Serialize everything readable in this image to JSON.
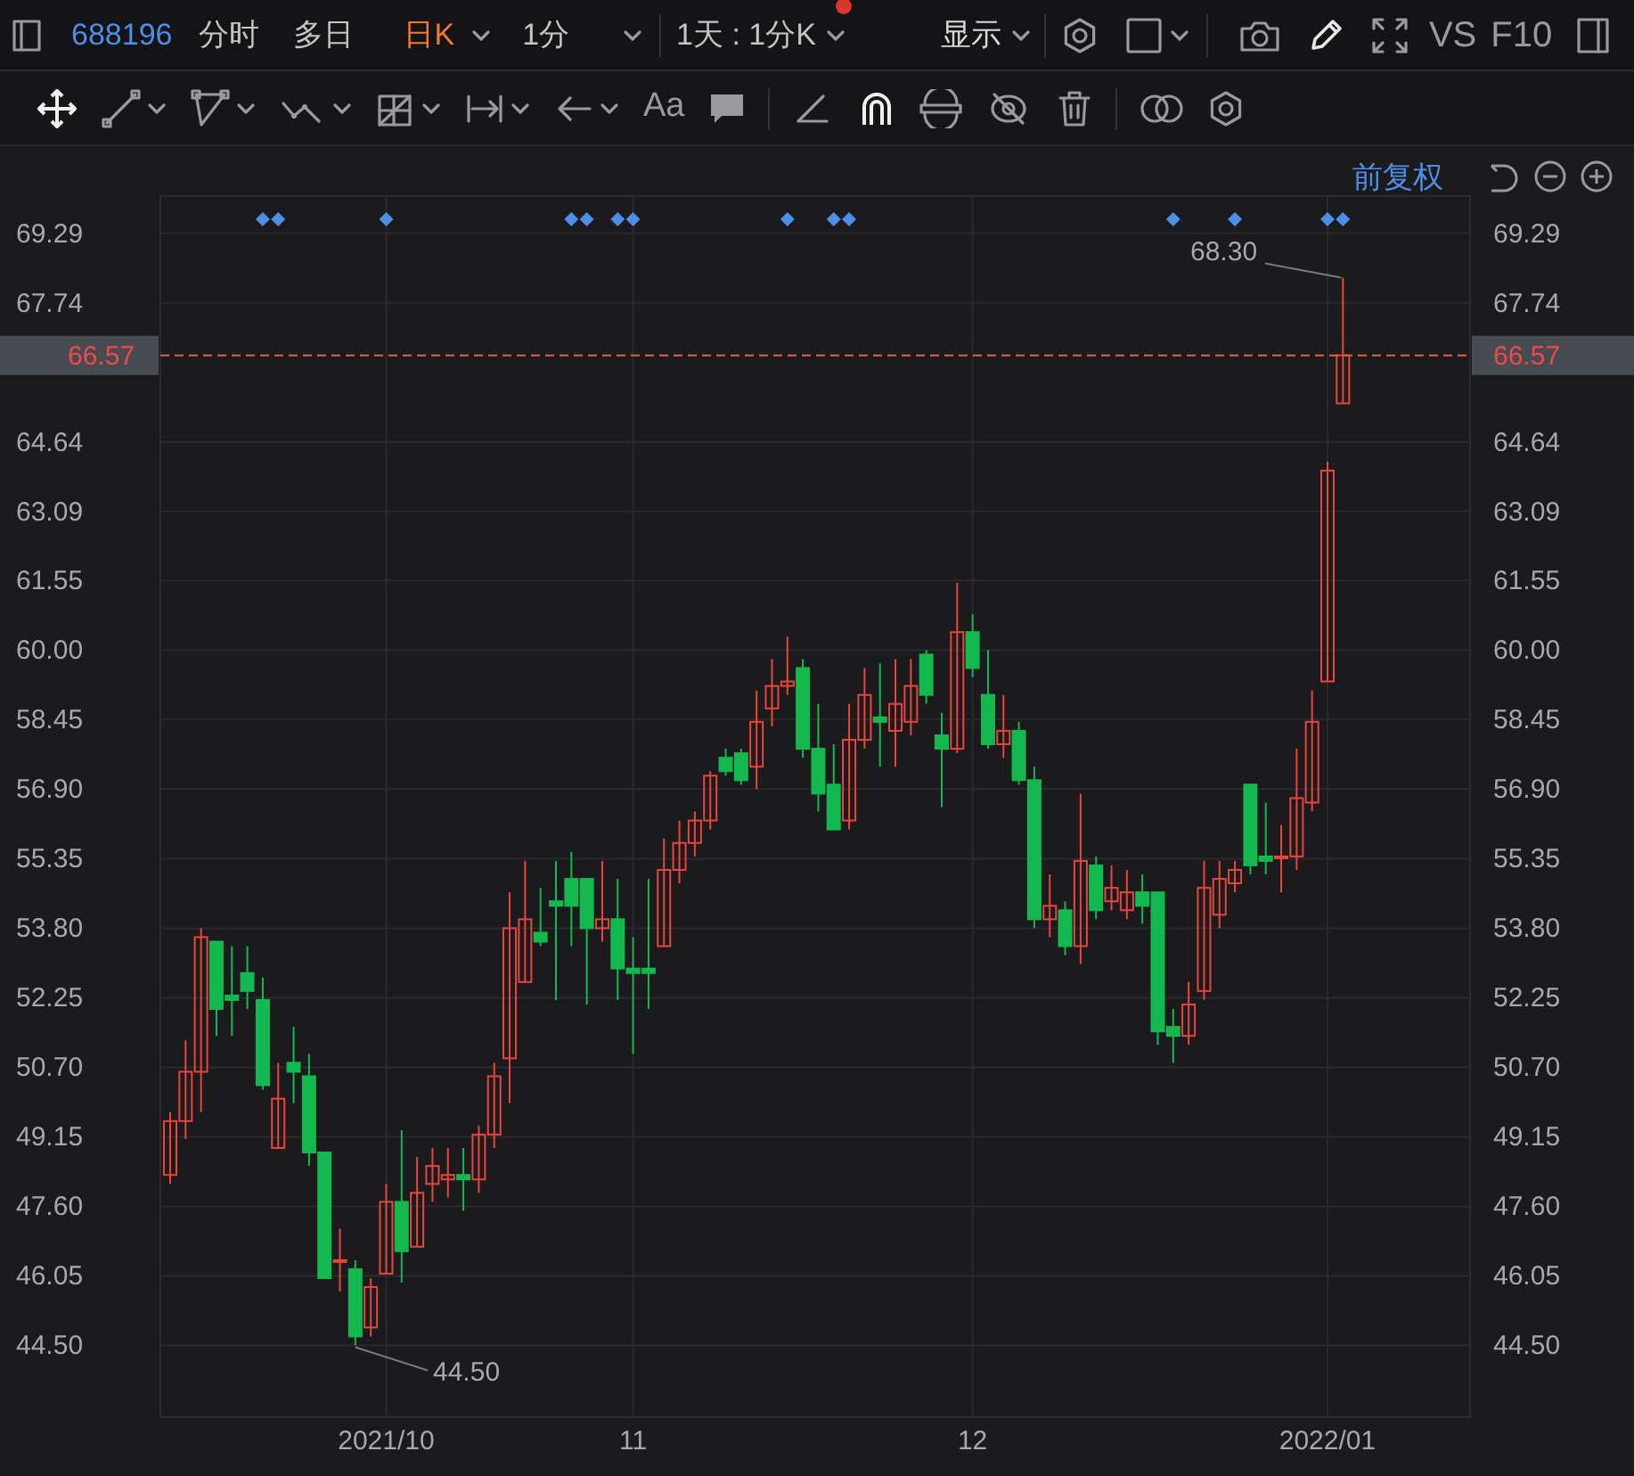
{
  "header": {
    "symbol": "688196",
    "period_tabs": [
      {
        "label": "分时",
        "selected": false
      },
      {
        "label": "多日",
        "selected": false
      },
      {
        "label": "日K",
        "selected": true
      },
      {
        "label": "1分",
        "selected": false
      }
    ],
    "interval": "1天 : 1分K",
    "interval_alert": true,
    "display_menu": "显示",
    "vs": "VS",
    "f10": "F10"
  },
  "drawing_toolbar": {
    "text_tool": "Aa"
  },
  "adjust_mode": "前复权",
  "chart_data": {
    "type": "candlestick",
    "grid": true,
    "ylim": [
      42.9,
      70.12
    ],
    "yticks": [
      {
        "value": 69.29,
        "label": "69.29"
      },
      {
        "value": 67.74,
        "label": "67.74"
      },
      {
        "value": 64.64,
        "label": "64.64"
      },
      {
        "value": 63.09,
        "label": "63.09"
      },
      {
        "value": 61.55,
        "label": "61.55"
      },
      {
        "value": 60,
        "label": "60.00"
      },
      {
        "value": 58.45,
        "label": "58.45"
      },
      {
        "value": 56.9,
        "label": "56.90"
      },
      {
        "value": 55.35,
        "label": "55.35"
      },
      {
        "value": 53.8,
        "label": "53.80"
      },
      {
        "value": 52.25,
        "label": "52.25"
      },
      {
        "value": 50.7,
        "label": "50.70"
      },
      {
        "value": 49.15,
        "label": "49.15"
      },
      {
        "value": 47.6,
        "label": "47.60"
      },
      {
        "value": 46.05,
        "label": "46.05"
      },
      {
        "value": 44.5,
        "label": "44.50"
      }
    ],
    "categories": [
      null,
      null,
      null,
      null,
      null,
      null,
      null,
      null,
      null,
      null,
      null,
      null,
      null,
      null,
      "2021/10",
      null,
      null,
      null,
      null,
      null,
      null,
      null,
      null,
      null,
      null,
      null,
      null,
      null,
      null,
      null,
      "11",
      null,
      null,
      null,
      null,
      null,
      null,
      null,
      null,
      null,
      null,
      null,
      null,
      null,
      null,
      null,
      null,
      null,
      null,
      null,
      null,
      null,
      "12",
      null,
      null,
      null,
      null,
      null,
      null,
      null,
      null,
      null,
      null,
      null,
      null,
      null,
      null,
      null,
      null,
      null,
      null,
      null,
      null,
      null,
      null,
      "2022/01",
      null
    ],
    "ohlc": [
      [
        48.3,
        49.7,
        48.1,
        49.5
      ],
      [
        49.5,
        51.3,
        49.1,
        50.6
      ],
      [
        50.6,
        53.8,
        49.7,
        53.6
      ],
      [
        53.5,
        53.5,
        51.4,
        52.0
      ],
      [
        52.3,
        53.4,
        51.4,
        52.2
      ],
      [
        52.8,
        53.4,
        52.0,
        52.4
      ],
      [
        52.2,
        52.7,
        50.2,
        50.3
      ],
      [
        48.9,
        50.8,
        48.9,
        50.0
      ],
      [
        50.8,
        51.6,
        49.9,
        50.6
      ],
      [
        50.5,
        51.0,
        48.5,
        48.8
      ],
      [
        48.8,
        48.8,
        46.0,
        46.0
      ],
      [
        46.4,
        47.1,
        45.7,
        46.4
      ],
      [
        46.2,
        46.4,
        44.5,
        44.7
      ],
      [
        44.9,
        46.0,
        44.7,
        45.8
      ],
      [
        46.1,
        48.1,
        46.1,
        47.7
      ],
      [
        47.7,
        49.3,
        45.9,
        46.6
      ],
      [
        46.7,
        48.7,
        46.7,
        47.9
      ],
      [
        48.1,
        48.9,
        47.7,
        48.5
      ],
      [
        48.2,
        48.9,
        47.8,
        48.3
      ],
      [
        48.3,
        48.9,
        47.5,
        48.2
      ],
      [
        48.2,
        49.4,
        47.9,
        49.2
      ],
      [
        49.2,
        50.8,
        48.9,
        50.5
      ],
      [
        50.9,
        54.6,
        49.9,
        53.8
      ],
      [
        52.6,
        55.3,
        52.6,
        54.0
      ],
      [
        53.7,
        54.7,
        53.4,
        53.5
      ],
      [
        54.4,
        55.3,
        52.2,
        54.3
      ],
      [
        54.9,
        55.5,
        53.4,
        54.3
      ],
      [
        54.9,
        54.9,
        52.1,
        53.8
      ],
      [
        53.8,
        55.3,
        53.5,
        54.0
      ],
      [
        54.0,
        54.9,
        52.2,
        52.9
      ],
      [
        52.9,
        53.6,
        51.0,
        52.8
      ],
      [
        52.9,
        54.9,
        52.0,
        52.8
      ],
      [
        53.4,
        55.8,
        53.4,
        55.1
      ],
      [
        55.1,
        56.2,
        54.8,
        55.7
      ],
      [
        55.7,
        56.4,
        55.4,
        56.2
      ],
      [
        56.2,
        57.3,
        56.0,
        57.2
      ],
      [
        57.6,
        57.8,
        57.2,
        57.3
      ],
      [
        57.7,
        57.8,
        57.0,
        57.1
      ],
      [
        57.4,
        59.1,
        56.9,
        58.4
      ],
      [
        58.7,
        59.8,
        58.3,
        59.2
      ],
      [
        59.2,
        60.3,
        59.0,
        59.3
      ],
      [
        59.6,
        59.8,
        57.6,
        57.8
      ],
      [
        57.8,
        58.8,
        56.4,
        56.8
      ],
      [
        57.0,
        57.9,
        56.0,
        56.0
      ],
      [
        56.2,
        58.8,
        56.0,
        58.0
      ],
      [
        58.0,
        59.6,
        57.8,
        59.0
      ],
      [
        58.5,
        59.7,
        57.4,
        58.4
      ],
      [
        58.2,
        59.8,
        57.4,
        58.8
      ],
      [
        58.4,
        59.8,
        58.1,
        59.2
      ],
      [
        59.9,
        60.0,
        58.8,
        59.0
      ],
      [
        58.1,
        58.6,
        56.5,
        57.8
      ],
      [
        57.8,
        61.5,
        57.7,
        60.4
      ],
      [
        60.4,
        60.8,
        59.4,
        59.6
      ],
      [
        59.0,
        60.0,
        57.8,
        57.9
      ],
      [
        57.9,
        59.0,
        57.6,
        58.2
      ],
      [
        58.2,
        58.4,
        57.0,
        57.1
      ],
      [
        57.1,
        57.4,
        53.8,
        54.0
      ],
      [
        54.0,
        55.0,
        53.6,
        54.3
      ],
      [
        54.2,
        54.4,
        53.2,
        53.4
      ],
      [
        53.4,
        56.8,
        53.0,
        55.3
      ],
      [
        55.2,
        55.4,
        54.0,
        54.2
      ],
      [
        54.4,
        55.2,
        54.2,
        54.7
      ],
      [
        54.2,
        55.1,
        54.0,
        54.6
      ],
      [
        54.6,
        55.0,
        53.9,
        54.3
      ],
      [
        54.6,
        54.6,
        51.2,
        51.5
      ],
      [
        51.6,
        52.0,
        50.8,
        51.4
      ],
      [
        51.4,
        52.6,
        51.2,
        52.1
      ],
      [
        52.4,
        55.3,
        52.2,
        54.7
      ],
      [
        54.1,
        55.3,
        53.8,
        54.9
      ],
      [
        54.8,
        55.3,
        54.6,
        55.1
      ],
      [
        57.0,
        57.0,
        55.0,
        55.2
      ],
      [
        55.4,
        56.6,
        55.0,
        55.3
      ],
      [
        55.4,
        56.1,
        54.6,
        55.4
      ],
      [
        55.4,
        57.8,
        55.1,
        56.7
      ],
      [
        56.6,
        59.1,
        56.4,
        58.4
      ],
      [
        59.3,
        64.2,
        59.3,
        64.0
      ],
      [
        65.5,
        68.3,
        65.5,
        66.57
      ]
    ],
    "ref_lines": [
      {
        "axis": "y",
        "value": 66.57,
        "label": "66.57"
      }
    ],
    "annotations": [
      "66.57",
      "68.30",
      "44.50"
    ]
  }
}
